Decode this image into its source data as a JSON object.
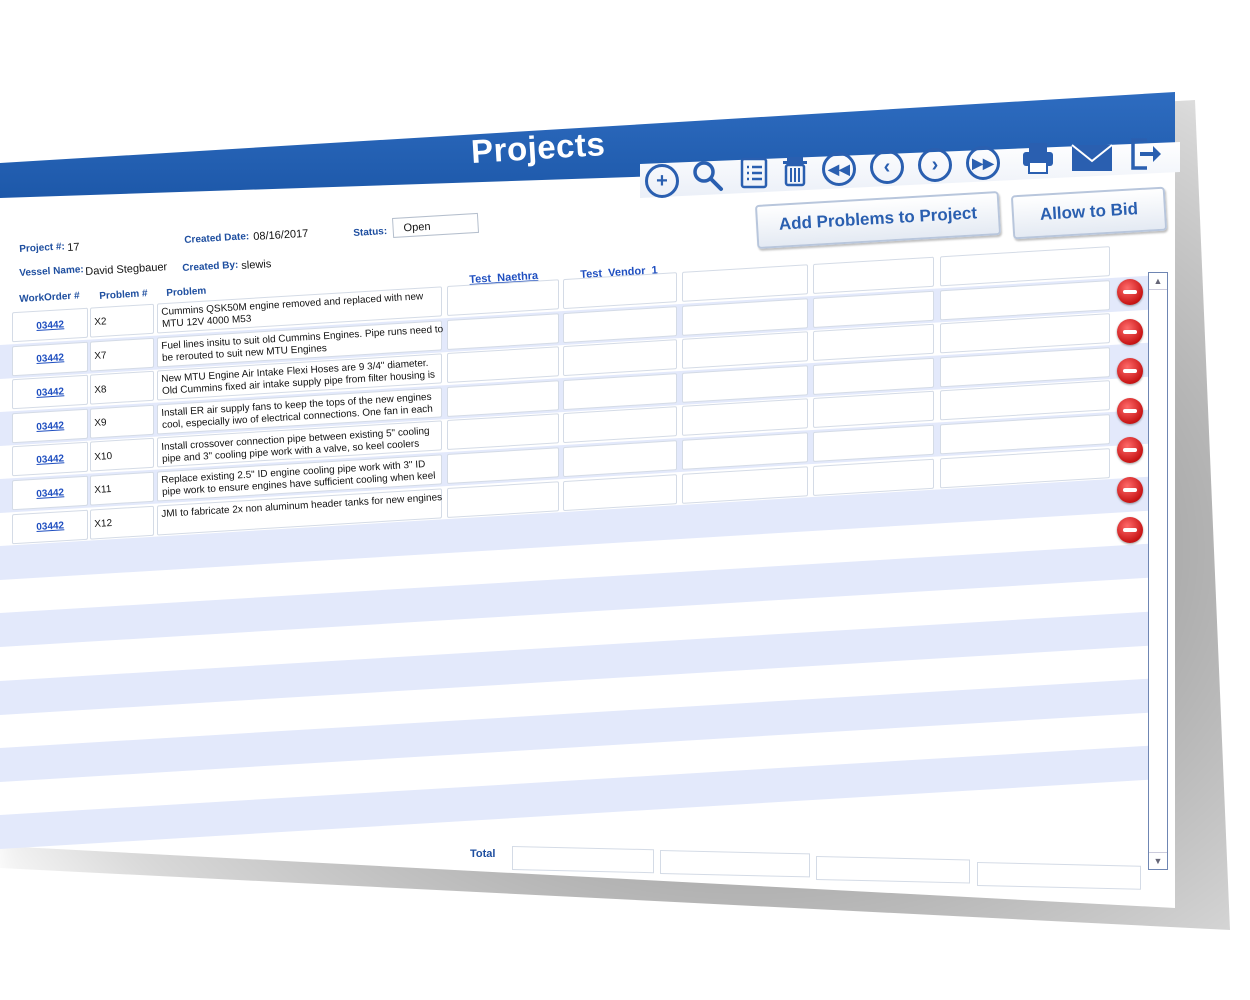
{
  "window": {
    "title": "Projects"
  },
  "toolbar": {
    "icons": [
      "add-icon",
      "search-icon",
      "list-icon",
      "trash-icon",
      "first-icon",
      "previous-icon",
      "next-icon",
      "last-icon",
      "print-icon",
      "mail-icon",
      "exit-icon"
    ],
    "add_problems_label": "Add Problems to Project",
    "allow_bid_label": "Allow to Bid"
  },
  "header": {
    "project_label": "Project #:",
    "project_value": "17",
    "created_date_label": "Created Date:",
    "created_date_value": "08/16/2017",
    "status_label": "Status:",
    "status_value": "Open",
    "vessel_label": "Vessel Name:",
    "vessel_value": "David Stegbauer",
    "created_by_label": "Created By:",
    "created_by_value": "slewis"
  },
  "columns": {
    "workorder": "WorkOrder #",
    "problem_num": "Problem #",
    "problem": "Problem",
    "vendors": [
      "Test_Naethra",
      "Test_Vendor_1"
    ]
  },
  "rows": [
    {
      "workorder": "03442",
      "problem_num": "X2",
      "problem": "Cummins QSK50M engine removed and replaced with new MTU 12V 4000 M53"
    },
    {
      "workorder": "03442",
      "problem_num": "X7",
      "problem": "Fuel lines insitu to suit old Cummins Engines. Pipe runs need to be rerouted to suit new MTU Engines"
    },
    {
      "workorder": "03442",
      "problem_num": "X8",
      "problem": "New MTU Engine Air Intake Flexi Hoses are 9 3/4\" diameter. Old Cummins fixed air intake supply pipe from filter housing is"
    },
    {
      "workorder": "03442",
      "problem_num": "X9",
      "problem": "Install ER air supply fans to keep the tops of the new engines cool, especially iwo of electrical connections. One fan in each"
    },
    {
      "workorder": "03442",
      "problem_num": "X10",
      "problem": "Install crossover connection pipe between existing 5\" cooling pipe and 3\" cooling pipe work with a valve, so keel coolers"
    },
    {
      "workorder": "03442",
      "problem_num": "X11",
      "problem": "Replace existing 2.5\" ID engine cooling pipe work with 3\" ID pipe work to ensure engines have sufficient cooling when keel"
    },
    {
      "workorder": "03442",
      "problem_num": "X12",
      "problem": "JMI to fabricate 2x non aluminum header tanks for new engines"
    }
  ],
  "footer": {
    "total_label": "Total"
  },
  "colors": {
    "accent": "#1f57a8",
    "stripe": "#e3e9fb",
    "link": "#1f4fc0",
    "delete": "#c81515"
  }
}
